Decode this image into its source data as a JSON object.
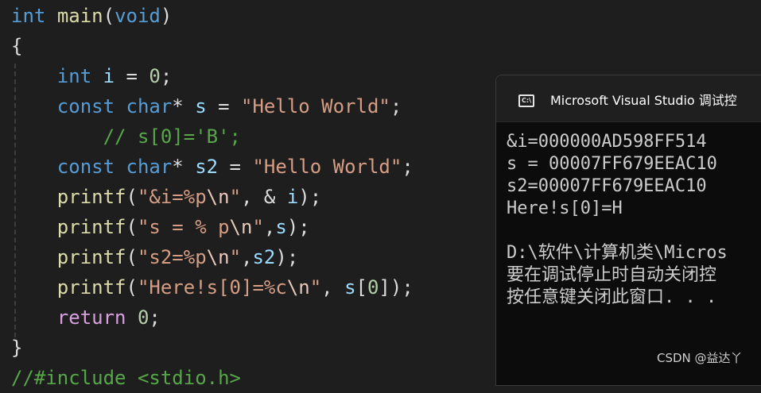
{
  "editor": {
    "lines": [
      {
        "tokens": [
          {
            "t": "int",
            "c": "kw"
          },
          {
            "t": " ",
            "c": "punc"
          },
          {
            "t": "main",
            "c": "fn"
          },
          {
            "t": "(",
            "c": "punc"
          },
          {
            "t": "void",
            "c": "kw"
          },
          {
            "t": ")",
            "c": "punc"
          }
        ]
      },
      {
        "tokens": [
          {
            "t": "{",
            "c": "punc"
          }
        ]
      },
      {
        "tokens": [
          {
            "t": "    ",
            "c": "punc"
          },
          {
            "t": "int",
            "c": "kw"
          },
          {
            "t": " ",
            "c": "punc"
          },
          {
            "t": "i",
            "c": "var"
          },
          {
            "t": " = ",
            "c": "punc"
          },
          {
            "t": "0",
            "c": "num"
          },
          {
            "t": ";",
            "c": "punc"
          }
        ]
      },
      {
        "tokens": [
          {
            "t": "    ",
            "c": "punc"
          },
          {
            "t": "const",
            "c": "kw"
          },
          {
            "t": " ",
            "c": "punc"
          },
          {
            "t": "char",
            "c": "kw"
          },
          {
            "t": "* ",
            "c": "punc"
          },
          {
            "t": "s",
            "c": "var"
          },
          {
            "t": " = ",
            "c": "punc"
          },
          {
            "t": "\"Hello World\"",
            "c": "str"
          },
          {
            "t": ";",
            "c": "punc"
          }
        ]
      },
      {
        "tokens": [
          {
            "t": "        // s[0]='B';",
            "c": "cmt"
          }
        ]
      },
      {
        "tokens": [
          {
            "t": "    ",
            "c": "punc"
          },
          {
            "t": "const",
            "c": "kw"
          },
          {
            "t": " ",
            "c": "punc"
          },
          {
            "t": "char",
            "c": "kw"
          },
          {
            "t": "* ",
            "c": "punc"
          },
          {
            "t": "s2",
            "c": "var"
          },
          {
            "t": " = ",
            "c": "punc"
          },
          {
            "t": "\"Hello World\"",
            "c": "str"
          },
          {
            "t": ";",
            "c": "punc"
          }
        ]
      },
      {
        "tokens": [
          {
            "t": "    ",
            "c": "punc"
          },
          {
            "t": "printf",
            "c": "fn"
          },
          {
            "t": "(",
            "c": "punc"
          },
          {
            "t": "\"&i=%p",
            "c": "str"
          },
          {
            "t": "\\n",
            "c": "esc"
          },
          {
            "t": "\"",
            "c": "str"
          },
          {
            "t": ", & ",
            "c": "punc"
          },
          {
            "t": "i",
            "c": "var"
          },
          {
            "t": ");",
            "c": "punc"
          }
        ]
      },
      {
        "tokens": [
          {
            "t": "    ",
            "c": "punc"
          },
          {
            "t": "printf",
            "c": "fn"
          },
          {
            "t": "(",
            "c": "punc"
          },
          {
            "t": "\"s = % p",
            "c": "str"
          },
          {
            "t": "\\n",
            "c": "esc"
          },
          {
            "t": "\"",
            "c": "str"
          },
          {
            "t": ",",
            "c": "punc"
          },
          {
            "t": "s",
            "c": "var"
          },
          {
            "t": ");",
            "c": "punc"
          }
        ]
      },
      {
        "tokens": [
          {
            "t": "    ",
            "c": "punc"
          },
          {
            "t": "printf",
            "c": "fn"
          },
          {
            "t": "(",
            "c": "punc"
          },
          {
            "t": "\"s2=%p",
            "c": "str"
          },
          {
            "t": "\\n",
            "c": "esc"
          },
          {
            "t": "\"",
            "c": "str"
          },
          {
            "t": ",",
            "c": "punc"
          },
          {
            "t": "s2",
            "c": "var"
          },
          {
            "t": ");",
            "c": "punc"
          }
        ]
      },
      {
        "tokens": [
          {
            "t": "    ",
            "c": "punc"
          },
          {
            "t": "printf",
            "c": "fn"
          },
          {
            "t": "(",
            "c": "punc"
          },
          {
            "t": "\"Here!s[0]=%c",
            "c": "str"
          },
          {
            "t": "\\n",
            "c": "esc"
          },
          {
            "t": "\"",
            "c": "str"
          },
          {
            "t": ", ",
            "c": "punc"
          },
          {
            "t": "s",
            "c": "var"
          },
          {
            "t": "[",
            "c": "punc"
          },
          {
            "t": "0",
            "c": "num"
          },
          {
            "t": "]);",
            "c": "punc"
          }
        ]
      },
      {
        "tokens": [
          {
            "t": "    ",
            "c": "punc"
          },
          {
            "t": "return",
            "c": "ctl"
          },
          {
            "t": " ",
            "c": "punc"
          },
          {
            "t": "0",
            "c": "num"
          },
          {
            "t": ";",
            "c": "punc"
          }
        ]
      },
      {
        "tokens": [
          {
            "t": "}",
            "c": "punc"
          }
        ]
      },
      {
        "tokens": [
          {
            "t": "//#include <stdio.h>",
            "c": "cmt"
          }
        ]
      }
    ]
  },
  "console": {
    "icon": "console-icon",
    "icon_glyph": "C:\\",
    "title": "Microsoft Visual Studio 调试控",
    "output": [
      "&i=000000AD598FF514",
      "s = 00007FF679EEAC10",
      "s2=00007FF679EEAC10",
      "Here!s[0]=H",
      "",
      "D:\\软件\\计算机类\\Micros",
      "要在调试停止时自动关闭控",
      "按任意键关闭此窗口. . ."
    ]
  },
  "watermark": "CSDN @益达丫"
}
